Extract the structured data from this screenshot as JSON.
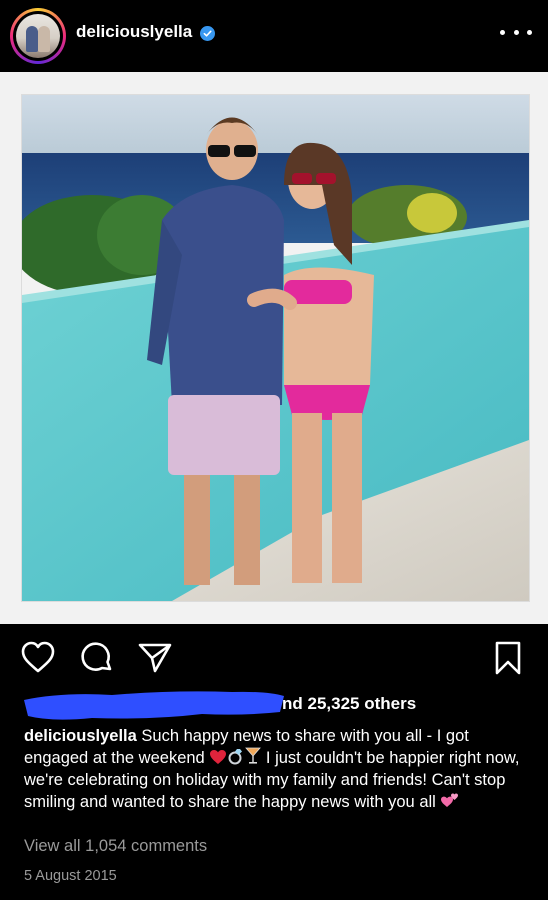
{
  "header": {
    "username": "deliciouslyella",
    "verified": true,
    "more_icon": "more-horizontal-icon"
  },
  "actions": {
    "icons": [
      "heart-icon",
      "comment-icon",
      "share-icon",
      "bookmark-icon"
    ]
  },
  "likes": {
    "text": "nd 25,325 others"
  },
  "caption": {
    "username": "deliciouslyella",
    "text_part1": " Such happy news to share with you all - I got engaged at the weekend ",
    "text_part2": " I just couldn't be happier right now, we're celebrating on holiday with my family and friends! Can't stop smiling and wanted to share the happy news with you all "
  },
  "comments": {
    "label": "View all 1,054 comments"
  },
  "date": {
    "label": "5 August 2015"
  },
  "colors": {
    "background": "#000000",
    "verified_blue": "#3897f0",
    "muted_text": "#9a9a9a",
    "redaction_blue": "#2f4fff",
    "pool": "#52c6c9"
  }
}
